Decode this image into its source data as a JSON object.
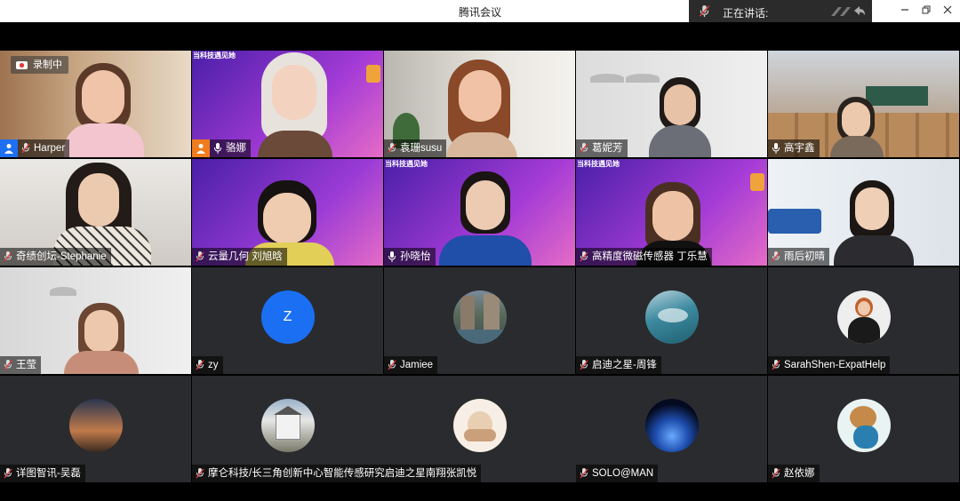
{
  "window": {
    "title": "腾讯会议",
    "speaking_label": "正在讲话:"
  },
  "recording": {
    "label": "录制中"
  },
  "banner_text": "当科技遇见她",
  "participants": [
    {
      "name": "Harper",
      "host": true
    },
    {
      "name": "骆娜",
      "host": true
    },
    {
      "name": "袁珊susu"
    },
    {
      "name": "葛妮芳"
    },
    {
      "name": "高宇鑫"
    },
    {
      "name": "奇绩创坛-Stephanie"
    },
    {
      "name": "云量几何 刘旭晗"
    },
    {
      "name": "孙晓怡"
    },
    {
      "name": "高精度微磁传感器 丁乐慧"
    },
    {
      "name": "雨后初晴"
    },
    {
      "name": "王莹"
    },
    {
      "name": "zy",
      "avatar_letter": "Z"
    },
    {
      "name": "Jamiee"
    },
    {
      "name": "启迪之星-周锋"
    },
    {
      "name": "SarahShen-ExpatHelp"
    },
    {
      "name": "详图智讯-吴磊"
    },
    {
      "name": "摩仑科技/长三角创新中心智能传感研究"
    },
    {
      "name": "启迪之星南翔张凯悦"
    },
    {
      "name": "SOLO@MAN"
    },
    {
      "name": "赵依娜"
    }
  ],
  "colors": {
    "accent_blue": "#1a6ff3",
    "host_orange": "#f07c1e",
    "tile_bg": "#2a2b2e"
  }
}
